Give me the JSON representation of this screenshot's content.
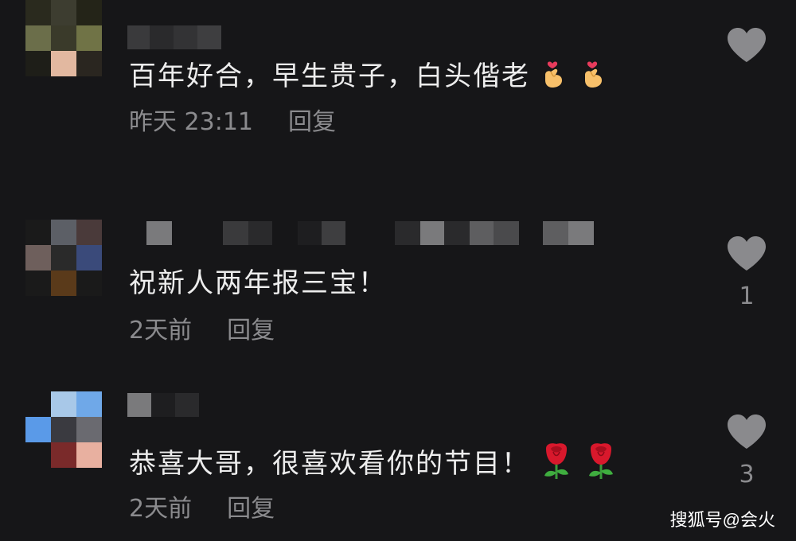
{
  "comments": [
    {
      "text": "百年好合，早生贵子，白头偕老",
      "emoji": "finger-heart",
      "time": "昨天 23:11",
      "reply_label": "回复",
      "likes": ""
    },
    {
      "text": "祝新人两年报三宝！",
      "emoji": "",
      "time": "2天前",
      "reply_label": "回复",
      "likes": "1"
    },
    {
      "text": "恭喜大哥，很喜欢看你的节目！",
      "emoji": "rose",
      "time": "2天前",
      "reply_label": "回复",
      "likes": "3"
    }
  ],
  "watermark": "搜狐号@会火",
  "colors": {
    "background": "#161618",
    "text": "#ededed",
    "meta": "#8b8b8e",
    "heart": "#8a8a8d"
  }
}
